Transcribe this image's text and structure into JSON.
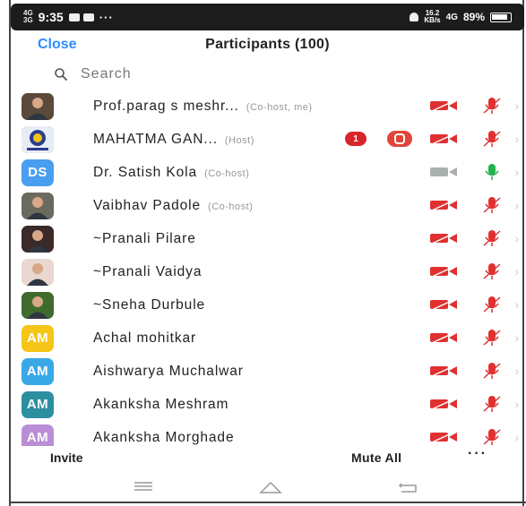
{
  "status_bar": {
    "network_top": "4G",
    "network_bottom": "3G",
    "time": "9:35",
    "overflow": "···",
    "speed_top": "16.2",
    "speed_bottom": "KB/s",
    "signal": "4G",
    "battery": "89%"
  },
  "header": {
    "close_label": "Close",
    "title": "Participants (100)"
  },
  "search": {
    "placeholder": "Search"
  },
  "participants": [
    {
      "name": "Prof.parag s meshr...",
      "role": "(Co-host, me)",
      "avatar_type": "photo",
      "avatar_color": "#5a4a3a",
      "video": "off",
      "audio": "muted"
    },
    {
      "name": "MAHATMA GAN...",
      "role": "(Host)",
      "avatar_type": "logo",
      "avatar_color": "#2a3d8f",
      "badge": "1",
      "recording": true,
      "video": "off",
      "audio": "muted"
    },
    {
      "name": "Dr. Satish Kola",
      "role": "(Co-host)",
      "avatar_type": "initials",
      "initials": "DS",
      "avatar_color": "#4a9ef0",
      "video": "on",
      "audio": "unmuted"
    },
    {
      "name": "Vaibhav Padole",
      "role": "(Co-host)",
      "avatar_type": "photo",
      "avatar_color": "#6b6a5e",
      "video": "off",
      "audio": "muted"
    },
    {
      "name": "~Pranali Pilare",
      "role": "",
      "avatar_type": "photo",
      "avatar_color": "#3a2a2a",
      "video": "off",
      "audio": "muted"
    },
    {
      "name": "~Pranali Vaidya",
      "role": "",
      "avatar_type": "photo",
      "avatar_color": "#e8d8d0",
      "video": "off",
      "audio": "muted"
    },
    {
      "name": "~Sneha Durbule",
      "role": "",
      "avatar_type": "photo",
      "avatar_color": "#3f6b2e",
      "video": "off",
      "audio": "muted"
    },
    {
      "name": "Achal mohitkar",
      "role": "",
      "avatar_type": "initials",
      "initials": "AM",
      "avatar_color": "#f5c518",
      "video": "off",
      "audio": "muted"
    },
    {
      "name": "Aishwarya Muchalwar",
      "role": "",
      "avatar_type": "initials",
      "initials": "AM",
      "avatar_color": "#39a8e6",
      "video": "off",
      "audio": "muted"
    },
    {
      "name": "Akanksha Meshram",
      "role": "",
      "avatar_type": "initials",
      "initials": "AM",
      "avatar_color": "#2c8fa0",
      "video": "off",
      "audio": "muted"
    },
    {
      "name": "Akanksha Morghade",
      "role": "",
      "avatar_type": "initials",
      "initials": "AM",
      "avatar_color": "#b98ed6",
      "video": "off",
      "audio": "muted"
    }
  ],
  "footer": {
    "invite_label": "Invite",
    "mute_all_label": "Mute All",
    "more_label": "···"
  },
  "nav": {
    "menu_icon": "menu-icon",
    "home_icon": "home-icon",
    "back_icon": "back-icon"
  },
  "colors": {
    "accent": "#2d8cff",
    "muted_red": "#e03030",
    "unmuted_green": "#22b14c",
    "video_on_gray": "#aab0ae"
  }
}
